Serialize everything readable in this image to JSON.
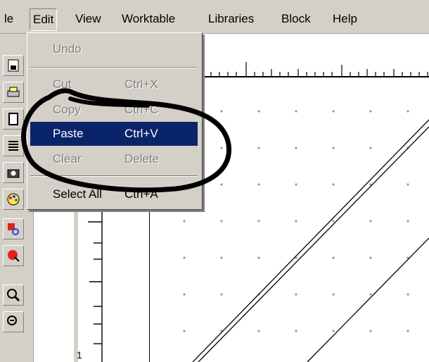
{
  "menubar": {
    "items": [
      "le",
      "Edit",
      "View",
      "Worktable",
      "Libraries",
      "Block",
      "Help"
    ],
    "active": "Edit"
  },
  "edit_menu": {
    "items": [
      {
        "label": "Undo",
        "shortcut": "",
        "enabled": false
      },
      {
        "label": "Cut",
        "shortcut": "Ctrl+X",
        "enabled": false
      },
      {
        "label": "Copy",
        "shortcut": "Ctrl+C",
        "enabled": false
      },
      {
        "label": "Paste",
        "shortcut": "Ctrl+V",
        "enabled": true,
        "highlighted": true
      },
      {
        "label": "Clear",
        "shortcut": "Delete",
        "enabled": false
      },
      {
        "label": "Select All",
        "shortcut": "Ctrl+A",
        "enabled": true
      }
    ]
  },
  "toolbar": {
    "icons": [
      "save-icon",
      "print-icon",
      "properties-icon",
      "library-icon",
      "camera-icon",
      "palette-icon",
      "select-color-icon",
      "fill-color-icon",
      "zoom-in-icon",
      "zoom-out-icon"
    ]
  },
  "ruler": {
    "vertical_label": "1"
  },
  "colors": {
    "menu_bg": "#d4d0c8",
    "highlight": "#0a246a",
    "disabled_text": "#808080",
    "annotation": "#000000"
  }
}
